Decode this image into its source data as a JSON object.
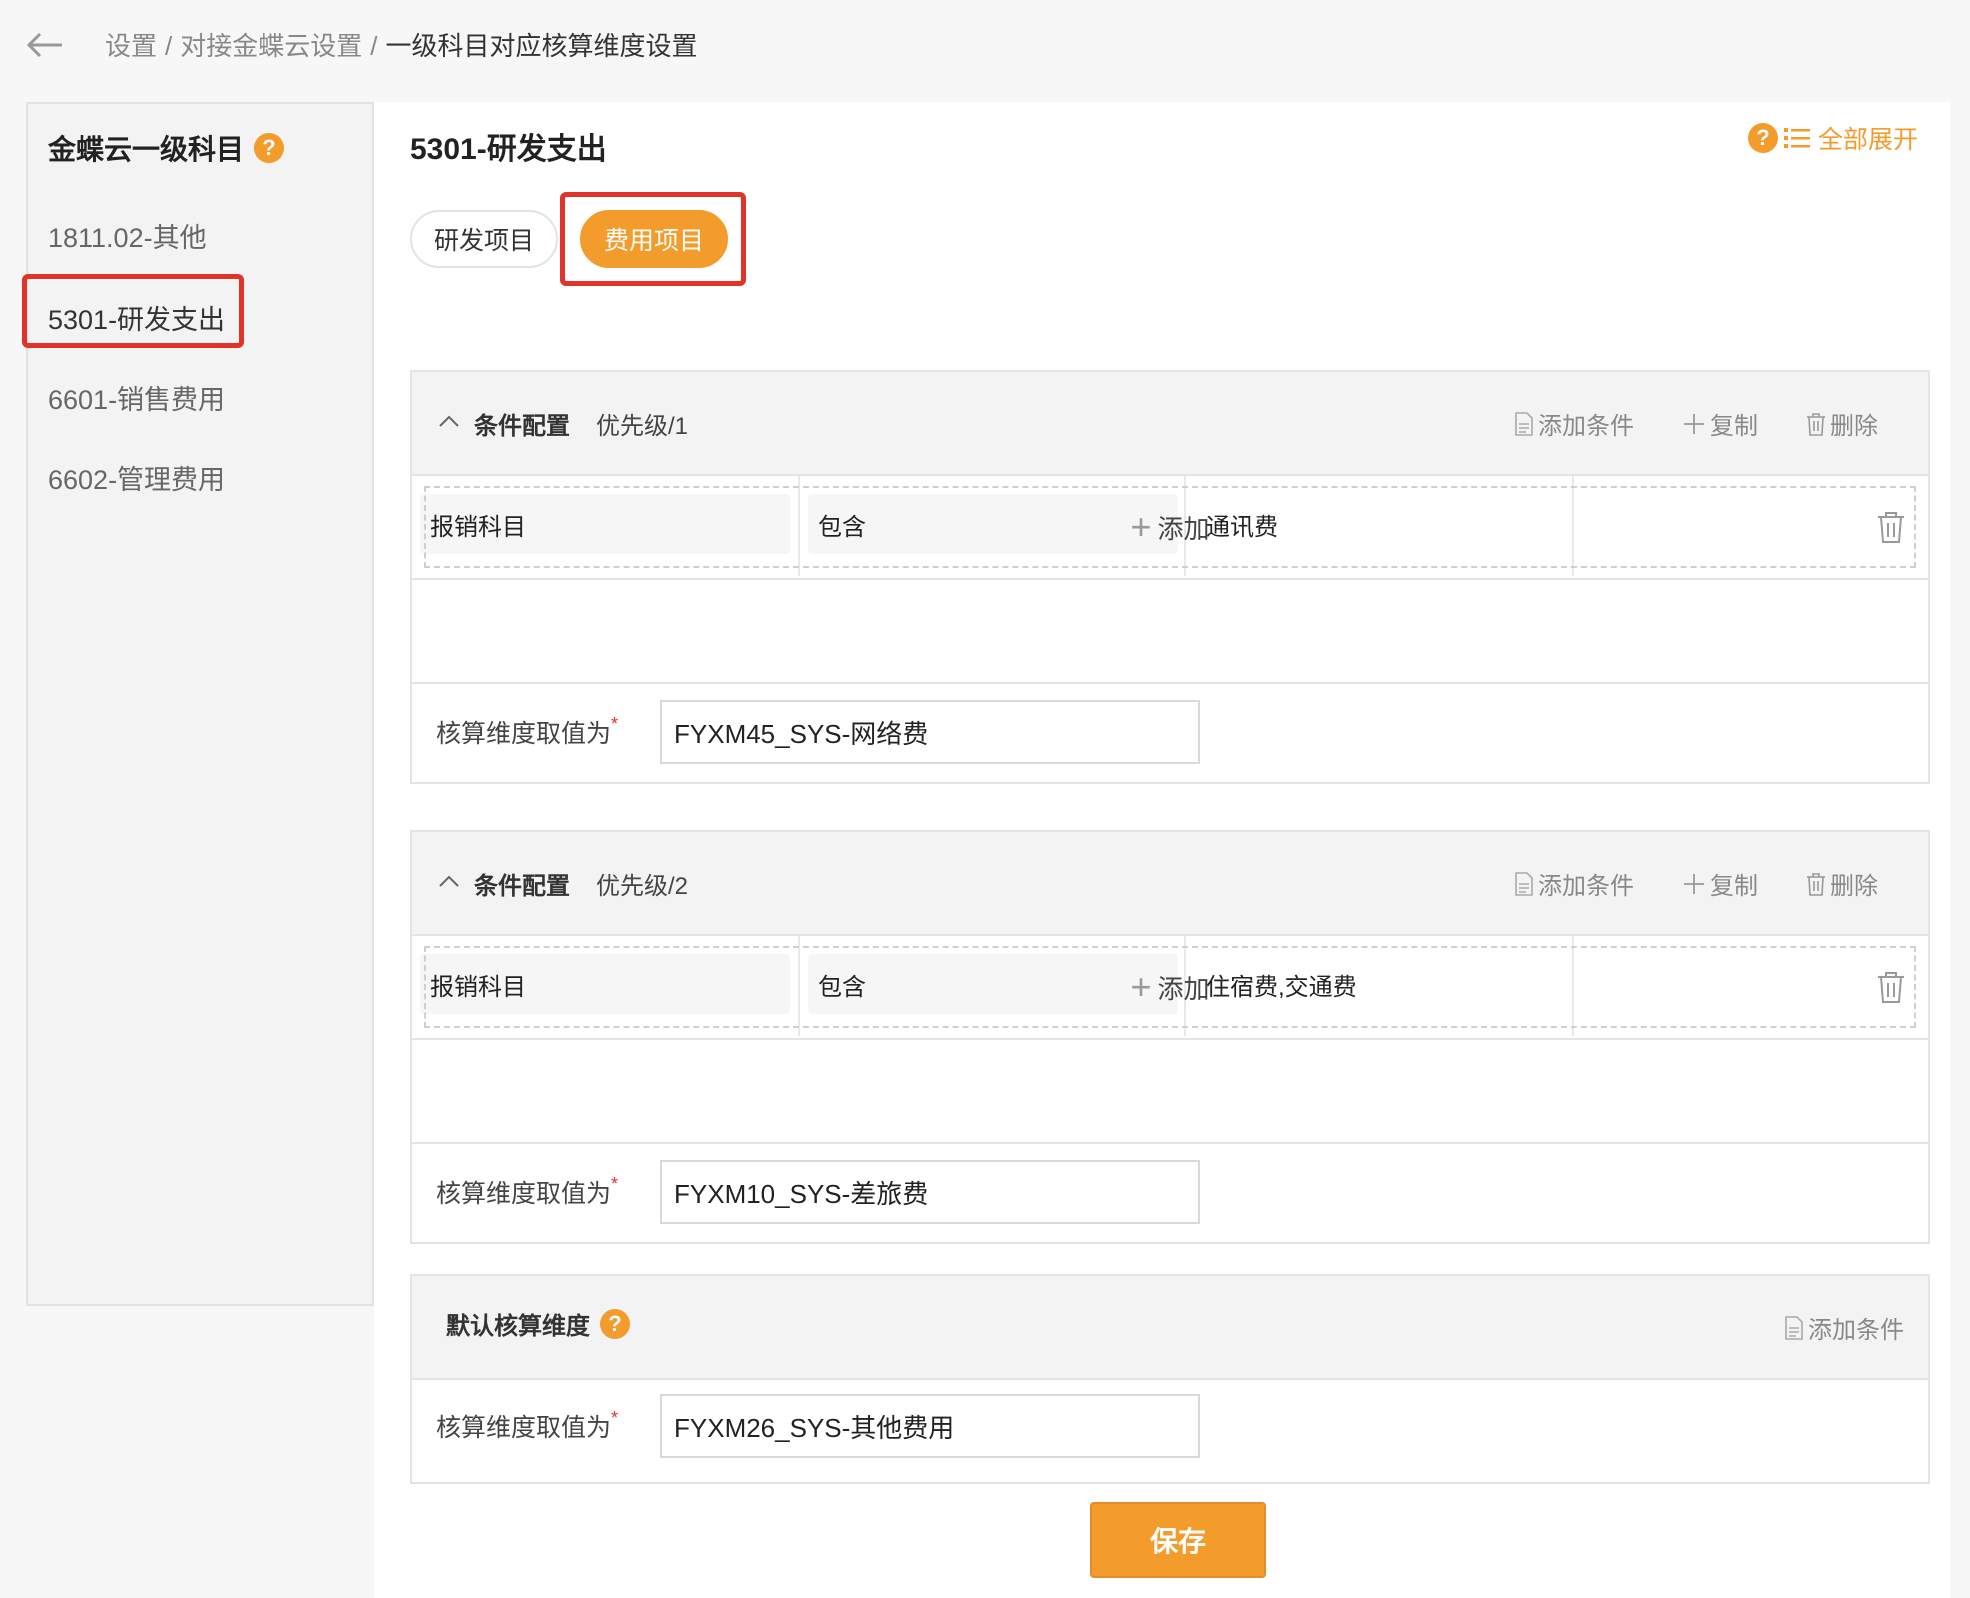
{
  "breadcrumb": {
    "items": [
      "设置",
      "对接金蝶云设置"
    ],
    "separator": "/",
    "current": "一级科目对应核算维度设置"
  },
  "sidebar": {
    "title": "金蝶云一级科目",
    "help": "?",
    "items": [
      {
        "label": "1811.02-其他"
      },
      {
        "label": "5301-研发支出"
      },
      {
        "label": "6601-销售费用"
      },
      {
        "label": "6602-管理费用"
      }
    ],
    "active_index": 1
  },
  "main": {
    "title": "5301-研发支出",
    "expand_all_help": "?",
    "expand_all": "全部展开",
    "tabs": [
      {
        "label": "研发项目"
      },
      {
        "label": "费用项目"
      }
    ],
    "active_tab": 1
  },
  "actions": {
    "add_condition": "添加条件",
    "copy": "复制",
    "delete": "删除",
    "add": "添加"
  },
  "cards": [
    {
      "title": "条件配置",
      "priority": "优先级/1",
      "condition": {
        "field": "报销科目",
        "op": "包含",
        "value": "通讯费"
      },
      "value_label": "核算维度取值为",
      "required_mark": "*",
      "value": "FYXM45_SYS-网络费"
    },
    {
      "title": "条件配置",
      "priority": "优先级/2",
      "condition": {
        "field": "报销科目",
        "op": "包含",
        "value": "住宿费,交通费"
      },
      "value_label": "核算维度取值为",
      "required_mark": "*",
      "value": "FYXM10_SYS-差旅费"
    }
  ],
  "default_card": {
    "title": "默认核算维度",
    "help": "?",
    "value_label": "核算维度取值为",
    "required_mark": "*",
    "value": "FYXM26_SYS-其他费用"
  },
  "save_label": "保存",
  "colors": {
    "accent": "#f39b2b",
    "highlight": "#e0342a"
  }
}
